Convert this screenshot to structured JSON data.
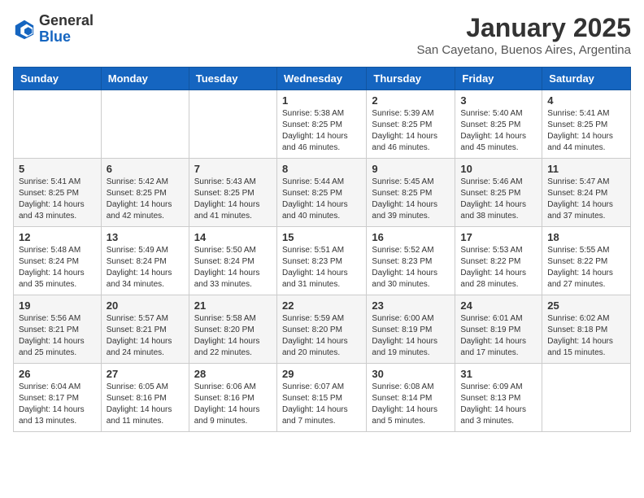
{
  "logo": {
    "general": "General",
    "blue": "Blue"
  },
  "title": "January 2025",
  "subtitle": "San Cayetano, Buenos Aires, Argentina",
  "days_of_week": [
    "Sunday",
    "Monday",
    "Tuesday",
    "Wednesday",
    "Thursday",
    "Friday",
    "Saturday"
  ],
  "weeks": [
    [
      {
        "day": "",
        "info": ""
      },
      {
        "day": "",
        "info": ""
      },
      {
        "day": "",
        "info": ""
      },
      {
        "day": "1",
        "info": "Sunrise: 5:38 AM\nSunset: 8:25 PM\nDaylight: 14 hours and 46 minutes."
      },
      {
        "day": "2",
        "info": "Sunrise: 5:39 AM\nSunset: 8:25 PM\nDaylight: 14 hours and 46 minutes."
      },
      {
        "day": "3",
        "info": "Sunrise: 5:40 AM\nSunset: 8:25 PM\nDaylight: 14 hours and 45 minutes."
      },
      {
        "day": "4",
        "info": "Sunrise: 5:41 AM\nSunset: 8:25 PM\nDaylight: 14 hours and 44 minutes."
      }
    ],
    [
      {
        "day": "5",
        "info": "Sunrise: 5:41 AM\nSunset: 8:25 PM\nDaylight: 14 hours and 43 minutes."
      },
      {
        "day": "6",
        "info": "Sunrise: 5:42 AM\nSunset: 8:25 PM\nDaylight: 14 hours and 42 minutes."
      },
      {
        "day": "7",
        "info": "Sunrise: 5:43 AM\nSunset: 8:25 PM\nDaylight: 14 hours and 41 minutes."
      },
      {
        "day": "8",
        "info": "Sunrise: 5:44 AM\nSunset: 8:25 PM\nDaylight: 14 hours and 40 minutes."
      },
      {
        "day": "9",
        "info": "Sunrise: 5:45 AM\nSunset: 8:25 PM\nDaylight: 14 hours and 39 minutes."
      },
      {
        "day": "10",
        "info": "Sunrise: 5:46 AM\nSunset: 8:25 PM\nDaylight: 14 hours and 38 minutes."
      },
      {
        "day": "11",
        "info": "Sunrise: 5:47 AM\nSunset: 8:24 PM\nDaylight: 14 hours and 37 minutes."
      }
    ],
    [
      {
        "day": "12",
        "info": "Sunrise: 5:48 AM\nSunset: 8:24 PM\nDaylight: 14 hours and 35 minutes."
      },
      {
        "day": "13",
        "info": "Sunrise: 5:49 AM\nSunset: 8:24 PM\nDaylight: 14 hours and 34 minutes."
      },
      {
        "day": "14",
        "info": "Sunrise: 5:50 AM\nSunset: 8:24 PM\nDaylight: 14 hours and 33 minutes."
      },
      {
        "day": "15",
        "info": "Sunrise: 5:51 AM\nSunset: 8:23 PM\nDaylight: 14 hours and 31 minutes."
      },
      {
        "day": "16",
        "info": "Sunrise: 5:52 AM\nSunset: 8:23 PM\nDaylight: 14 hours and 30 minutes."
      },
      {
        "day": "17",
        "info": "Sunrise: 5:53 AM\nSunset: 8:22 PM\nDaylight: 14 hours and 28 minutes."
      },
      {
        "day": "18",
        "info": "Sunrise: 5:55 AM\nSunset: 8:22 PM\nDaylight: 14 hours and 27 minutes."
      }
    ],
    [
      {
        "day": "19",
        "info": "Sunrise: 5:56 AM\nSunset: 8:21 PM\nDaylight: 14 hours and 25 minutes."
      },
      {
        "day": "20",
        "info": "Sunrise: 5:57 AM\nSunset: 8:21 PM\nDaylight: 14 hours and 24 minutes."
      },
      {
        "day": "21",
        "info": "Sunrise: 5:58 AM\nSunset: 8:20 PM\nDaylight: 14 hours and 22 minutes."
      },
      {
        "day": "22",
        "info": "Sunrise: 5:59 AM\nSunset: 8:20 PM\nDaylight: 14 hours and 20 minutes."
      },
      {
        "day": "23",
        "info": "Sunrise: 6:00 AM\nSunset: 8:19 PM\nDaylight: 14 hours and 19 minutes."
      },
      {
        "day": "24",
        "info": "Sunrise: 6:01 AM\nSunset: 8:19 PM\nDaylight: 14 hours and 17 minutes."
      },
      {
        "day": "25",
        "info": "Sunrise: 6:02 AM\nSunset: 8:18 PM\nDaylight: 14 hours and 15 minutes."
      }
    ],
    [
      {
        "day": "26",
        "info": "Sunrise: 6:04 AM\nSunset: 8:17 PM\nDaylight: 14 hours and 13 minutes."
      },
      {
        "day": "27",
        "info": "Sunrise: 6:05 AM\nSunset: 8:16 PM\nDaylight: 14 hours and 11 minutes."
      },
      {
        "day": "28",
        "info": "Sunrise: 6:06 AM\nSunset: 8:16 PM\nDaylight: 14 hours and 9 minutes."
      },
      {
        "day": "29",
        "info": "Sunrise: 6:07 AM\nSunset: 8:15 PM\nDaylight: 14 hours and 7 minutes."
      },
      {
        "day": "30",
        "info": "Sunrise: 6:08 AM\nSunset: 8:14 PM\nDaylight: 14 hours and 5 minutes."
      },
      {
        "day": "31",
        "info": "Sunrise: 6:09 AM\nSunset: 8:13 PM\nDaylight: 14 hours and 3 minutes."
      },
      {
        "day": "",
        "info": ""
      }
    ]
  ]
}
